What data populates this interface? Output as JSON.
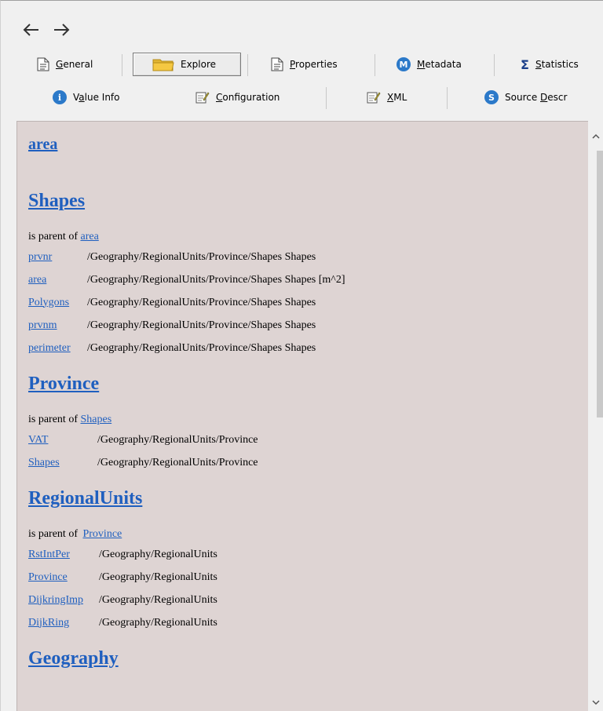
{
  "nav": {
    "back_icon": "arrow-left-icon",
    "forward_icon": "arrow-right-icon"
  },
  "toolbar": {
    "row1": [
      {
        "id": "general",
        "label_acc": "G",
        "label_rest": "eneral",
        "icon": "document-icon"
      },
      {
        "id": "explore",
        "label_acc": "",
        "label_rest": "Explore",
        "icon": "folder-icon",
        "active": true
      },
      {
        "id": "properties",
        "label_acc": "P",
        "label_rest": "roperties",
        "icon": "document-icon"
      },
      {
        "id": "metadata",
        "label_acc": "M",
        "label_rest": "etadata",
        "icon": "metadata-m-icon",
        "icon_glyph": "M"
      },
      {
        "id": "statistics",
        "label_acc": "S",
        "label_rest": "tatistics",
        "icon": "sigma-icon",
        "icon_glyph": "Σ"
      }
    ],
    "row2": [
      {
        "id": "value-info",
        "label_pre": "V",
        "label_acc": "a",
        "label_rest": "lue Info",
        "icon": "info-icon",
        "icon_glyph": "i"
      },
      {
        "id": "configuration",
        "label_acc": "C",
        "label_rest": "onfiguration",
        "icon": "edit-note-icon"
      },
      {
        "id": "xml",
        "label_acc": "X",
        "label_rest": "ML",
        "icon": "edit-note-icon"
      },
      {
        "id": "source-descr",
        "label_pre": "Source ",
        "label_acc": "D",
        "label_rest": "escr",
        "icon": "source-s-icon",
        "icon_glyph": "S"
      }
    ]
  },
  "content": {
    "top_link": "area",
    "sections": [
      {
        "title": "Shapes",
        "parent_prefix": "is parent of",
        "parent_link": "area",
        "rows": [
          {
            "name": "prvnr",
            "path": "/Geography/RegionalUnits/Province/Shapes Shapes"
          },
          {
            "name": "area",
            "path": "/Geography/RegionalUnits/Province/Shapes Shapes [m^2]"
          },
          {
            "name": "Polygons",
            "path": "/Geography/RegionalUnits/Province/Shapes Shapes"
          },
          {
            "name": "prvnm",
            "path": "/Geography/RegionalUnits/Province/Shapes Shapes"
          },
          {
            "name": "perimeter",
            "path": "/Geography/RegionalUnits/Province/Shapes Shapes"
          }
        ]
      },
      {
        "title": "Province",
        "parent_prefix": "is parent of",
        "parent_link": "Shapes",
        "rows": [
          {
            "name": "VAT",
            "path": "/Geography/RegionalUnits/Province"
          },
          {
            "name": "Shapes",
            "path": "/Geography/RegionalUnits/Province"
          }
        ]
      },
      {
        "title": "RegionalUnits",
        "parent_prefix": "is parent of",
        "parent_link": "Province",
        "rows": [
          {
            "name": "RstIntPer",
            "path": "/Geography/RegionalUnits"
          },
          {
            "name": "Province",
            "path": "/Geography/RegionalUnits"
          },
          {
            "name": "DijkringImp",
            "path": "/Geography/RegionalUnits"
          },
          {
            "name": "DijkRing",
            "path": "/Geography/RegionalUnits"
          }
        ]
      },
      {
        "title": "Geography",
        "parent_prefix": "",
        "parent_link": "",
        "rows": []
      }
    ]
  },
  "colors": {
    "content_bg": "#ded4d3",
    "link": "#1f5fbf",
    "icon_blue": "#2b79c9",
    "folder_yellow": "#f5c842"
  }
}
